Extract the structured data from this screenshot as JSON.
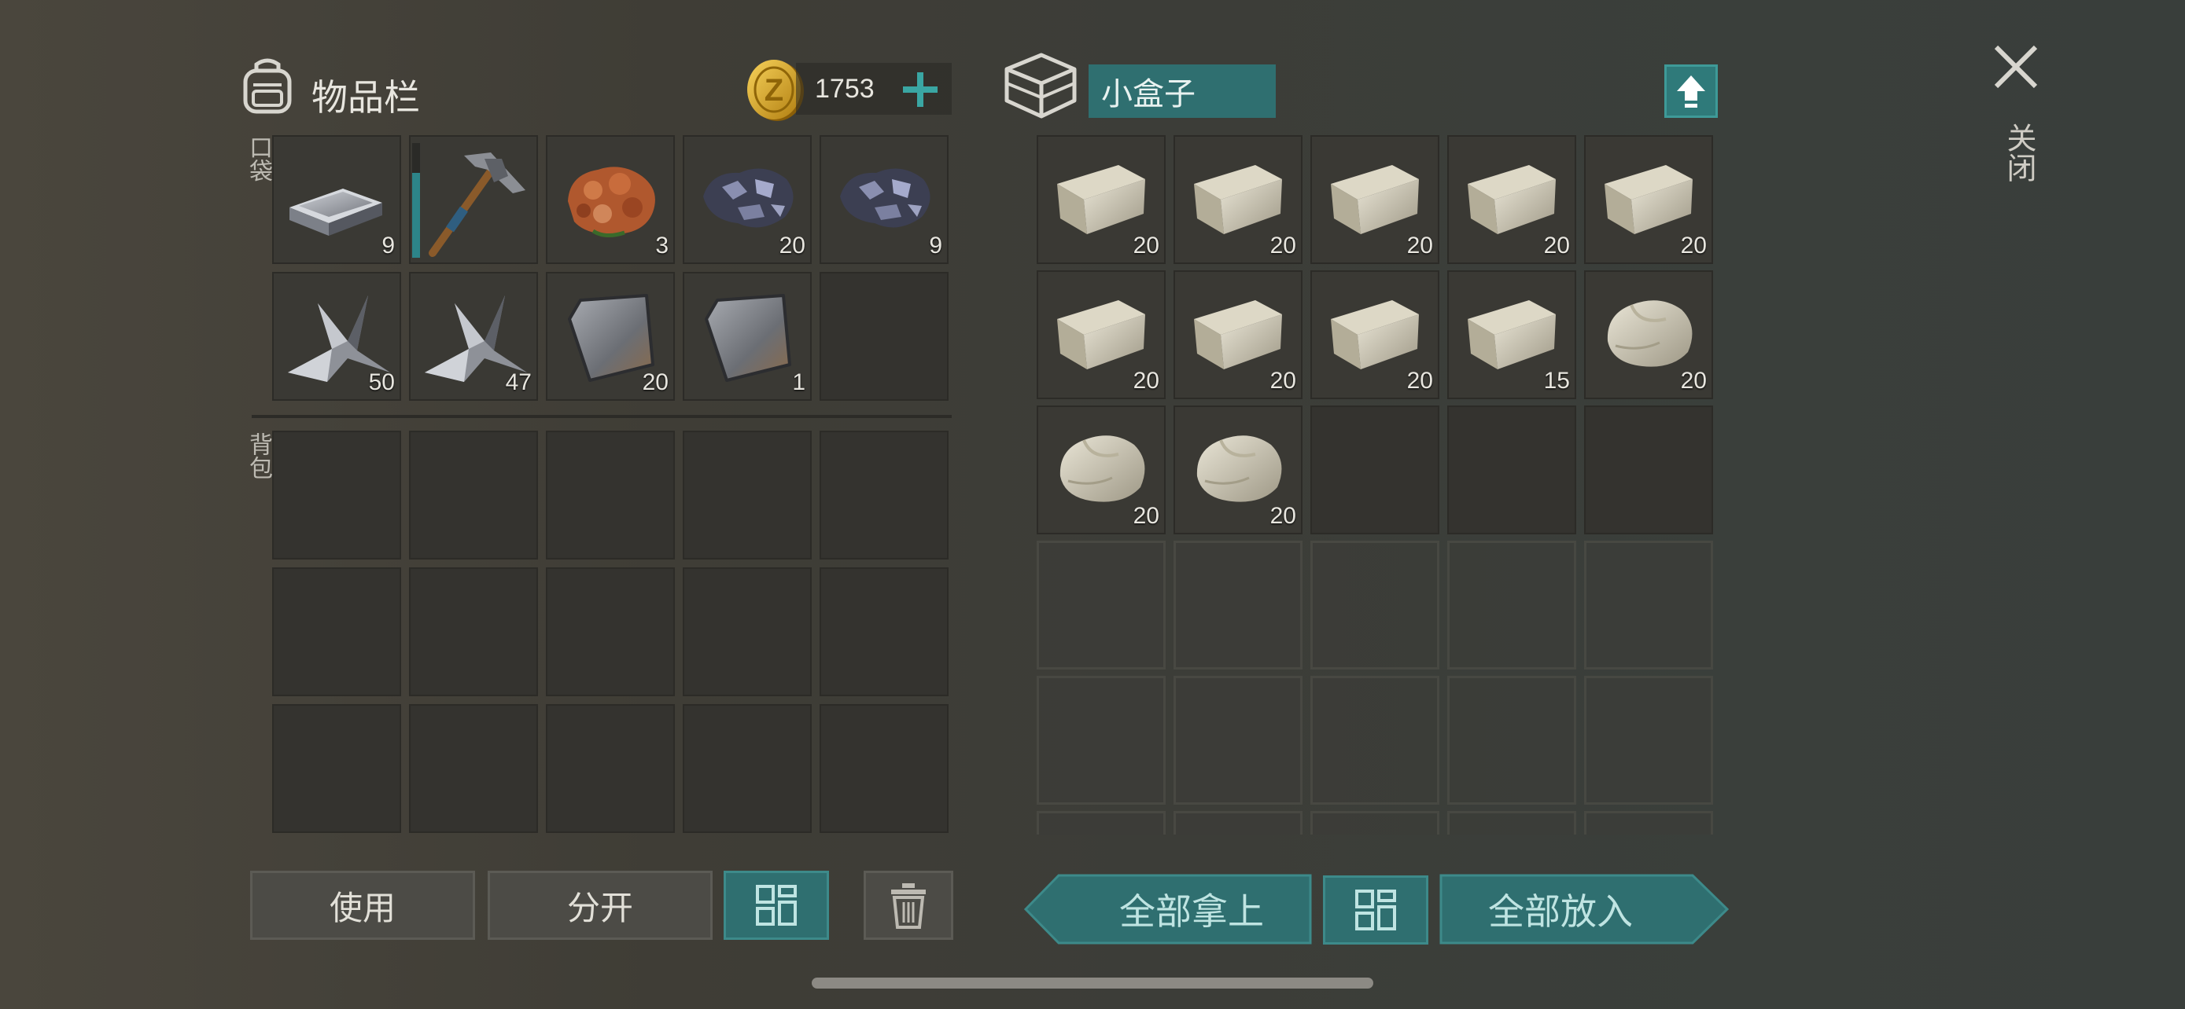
{
  "inventory": {
    "title": "物品栏",
    "pocket_label": "口袋",
    "backpack_label": "背包",
    "coins": "1753",
    "pocket_counts": [
      "9",
      "",
      "3",
      "20",
      "9",
      "50",
      "47",
      "20",
      "1",
      ""
    ]
  },
  "container": {
    "name": "小盒子",
    "counts": [
      "20",
      "20",
      "20",
      "20",
      "20",
      "20",
      "20",
      "20",
      "15",
      "20",
      "20",
      "20"
    ]
  },
  "buttons": {
    "use": "使用",
    "split": "分开",
    "take_all": "全部拿上",
    "put_all": "全部放入"
  },
  "close_label": "关闭",
  "icons": {
    "backpack": "backpack-icon",
    "coin": "coin-icon",
    "plus": "plus-icon",
    "box": "box-icon",
    "upload": "upload-icon",
    "close": "close-icon",
    "sort": "sort-icon",
    "trash": "trash-icon"
  },
  "colors": {
    "teal_button": "#2f6f70",
    "teal_accent": "#3aa6a3",
    "coin_gold": "#d9a520"
  }
}
